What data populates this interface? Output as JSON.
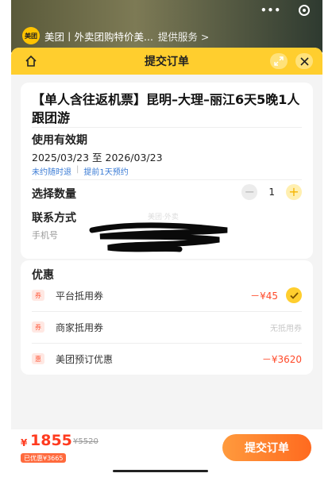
{
  "status_bar": {
    "dots": "•••"
  },
  "host": {
    "logo_text": "美团",
    "title": "美团丨外卖团购特价美...",
    "provider": "提供服务 >"
  },
  "sheet": {
    "title": "提交订单"
  },
  "product": {
    "title": "【单人含往返机票】昆明–大理–丽江6天5晚1人跟团游"
  },
  "validity": {
    "label": "使用有效期",
    "dates": "2025/03/23 至 2026/03/23",
    "tag_refund": "未约随时退",
    "tag_booking": "提前1天预约"
  },
  "quantity": {
    "label": "选择数量",
    "minus": "−",
    "value": "1",
    "plus": "+"
  },
  "contact": {
    "label": "联系方式",
    "phone_label": "手机号",
    "watermark": "美团·外卖"
  },
  "discounts": {
    "title": "优惠",
    "rows": [
      {
        "icon": "券",
        "name": "平台抵用券",
        "value": "－¥45",
        "checked": true
      },
      {
        "icon": "券",
        "name": "商家抵用券",
        "value": "无抵用券",
        "checked": false
      },
      {
        "icon": "惠",
        "name": "美团预订优惠",
        "value": "－¥3620",
        "checked": false
      }
    ]
  },
  "footer": {
    "currency": "¥",
    "price": "1855",
    "original_price": "¥5520",
    "saved": "已优惠¥3665",
    "submit": "提交订单"
  },
  "colors": {
    "brand_yellow": "#ffce2e",
    "price_red": "#ff3b1f",
    "link_blue": "#3a7bd5",
    "submit_orange": "#ff6a1f"
  }
}
